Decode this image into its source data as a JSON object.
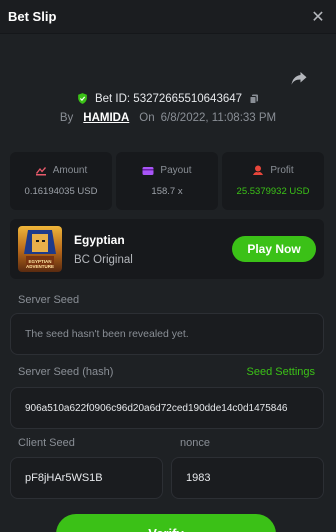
{
  "header": {
    "title": "Bet Slip"
  },
  "bet": {
    "id": "Bet ID: 53272665510643647",
    "by_label": "By",
    "user": "HAMIDA",
    "on_label": "On",
    "date": "6/8/2022, 11:08:33 PM"
  },
  "stats": {
    "amount": {
      "label": "Amount",
      "value": "0.16194035 USD"
    },
    "payout": {
      "label": "Payout",
      "value": "158.7 x"
    },
    "profit": {
      "label": "Profit",
      "value": "25.5379932 USD"
    }
  },
  "game": {
    "name": "Egyptian",
    "provider": "BC Original",
    "thumb_text": "EGYPTIAN ADVENTURE",
    "play_label": "Play Now"
  },
  "fields": {
    "server_seed_label": "Server Seed",
    "server_seed_value": "The seed hasn't been revealed yet.",
    "server_seed_hash_label": "Server Seed (hash)",
    "seed_settings_label": "Seed Settings",
    "server_seed_hash_value": "906a510a622f0906c96d20a6d72ced190dde14c0d1475846",
    "client_seed_label": "Client Seed",
    "client_seed_value": "pF8jHAr5WS1B",
    "nonce_label": "nonce",
    "nonce_value": "1983"
  },
  "verify": {
    "label": "Verify"
  },
  "colors": {
    "accent": "#3bc117",
    "background": "#1e2124",
    "card": "#17191c"
  }
}
